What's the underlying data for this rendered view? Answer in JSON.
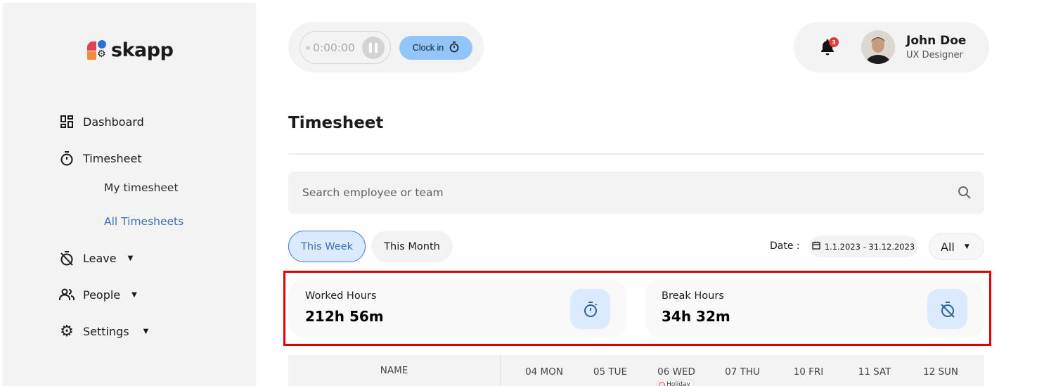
{
  "app": {
    "name": "skapp"
  },
  "sidebar": {
    "items": [
      {
        "label": "Dashboard",
        "icon": "dashboard-icon"
      },
      {
        "label": "Timesheet",
        "icon": "stopwatch-icon",
        "expanded": true,
        "children": [
          {
            "label": "My timesheet",
            "active": false
          },
          {
            "label": "All Timesheets",
            "active": true
          }
        ]
      },
      {
        "label": "Leave",
        "icon": "timer-off-icon",
        "has_dropdown": true
      },
      {
        "label": "People",
        "icon": "people-icon",
        "has_dropdown": true
      },
      {
        "label": "Settings",
        "icon": "gear-icon",
        "has_dropdown": true
      }
    ]
  },
  "timer": {
    "elapsed": "0:00:00",
    "pause_icon": "pause-icon",
    "clock_in_label": "Clock in",
    "clock_in_icon": "stopwatch-icon"
  },
  "user": {
    "notification_count": "3",
    "name": "John Doe",
    "role": "UX Designer"
  },
  "main": {
    "title": "Timesheet",
    "search": {
      "placeholder": "Search employee or team",
      "value": ""
    },
    "tabs": [
      {
        "label": "This Week",
        "active": true
      },
      {
        "label": "This Month",
        "active": false
      }
    ],
    "date_filter": {
      "label": "Date :",
      "range": "1.1.2023 - 31.12.2023"
    },
    "type_filter": {
      "selected": "All"
    },
    "stats": [
      {
        "label": "Worked Hours",
        "value": "212h 56m",
        "icon": "stopwatch-icon"
      },
      {
        "label": "Break Hours",
        "value": "34h 32m",
        "icon": "timer-off-icon"
      }
    ],
    "table": {
      "name_header": "NAME",
      "day_headers": [
        "04 MON",
        "05 TUE",
        "06 WED",
        "07 THU",
        "10 FRI",
        "11 SAT",
        "12 SUN"
      ],
      "holiday_label": "Holiday",
      "holiday_day": "06 WED"
    }
  },
  "colors": {
    "accent_blue": "#3d6fb4",
    "clock_in_bg": "#93c5fd",
    "stat_icon_bg": "#dbeafe",
    "badge_red": "#e53935",
    "highlight_red": "#e00000"
  }
}
